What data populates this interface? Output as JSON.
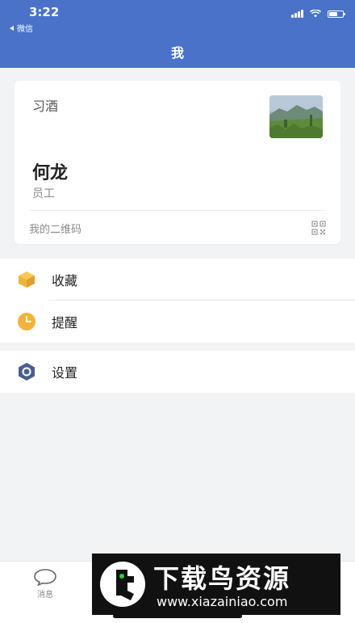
{
  "status_bar": {
    "time": "3:22",
    "back_label": "微信"
  },
  "header": {
    "title": "我",
    "background_color": "#4a72c8"
  },
  "profile": {
    "organization": "习酒",
    "name": "何龙",
    "role": "员工",
    "qr_label": "我的二维码",
    "avatar_icon": "landscape-photo"
  },
  "menu": {
    "group1": [
      {
        "label": "收藏",
        "icon": "box-icon",
        "color": "#f0b43c"
      },
      {
        "label": "提醒",
        "icon": "clock-icon",
        "color": "#f0b43c"
      }
    ],
    "group2": [
      {
        "label": "设置",
        "icon": "hexagon-gear-icon",
        "color": "#4a5f8f"
      }
    ]
  },
  "tabbar": {
    "messages_label": "消息"
  },
  "watermark": {
    "title": "下载鸟资源",
    "url": "www.xiazainiao.com"
  }
}
